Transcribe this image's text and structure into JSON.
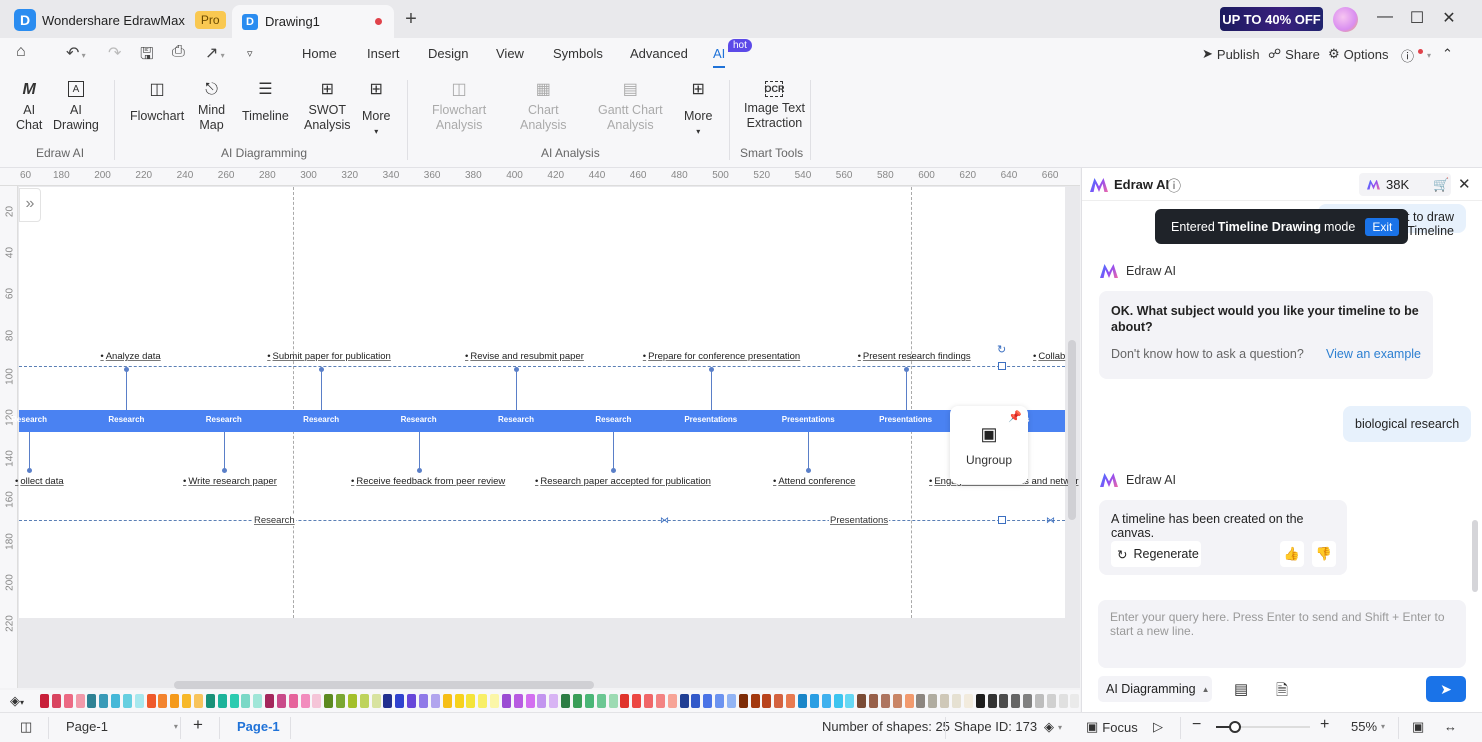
{
  "titlebar": {
    "app_name": "Wondershare EdrawMax",
    "pro_badge": "Pro",
    "doc_tab": "Drawing1",
    "promo": "UP TO 40% OFF"
  },
  "menubar": {
    "items": [
      "Home",
      "Insert",
      "Design",
      "View",
      "Symbols",
      "Advanced",
      "AI"
    ],
    "active": "AI",
    "hot_badge": "hot",
    "publish": "Publish",
    "share": "Share",
    "options": "Options"
  },
  "ribbon": {
    "groups": [
      {
        "label": "Edraw AI",
        "buttons": [
          {
            "label1": "AI",
            "label2": "Chat",
            "icon": "ai-chat-icon"
          },
          {
            "label1": "AI",
            "label2": "Drawing",
            "icon": "ai-drawing-icon"
          }
        ]
      },
      {
        "label": "AI Diagramming",
        "buttons": [
          {
            "label1": "Flowchart",
            "icon": "flowchart-icon"
          },
          {
            "label1": "Mind",
            "label2": "Map",
            "icon": "mind-map-icon"
          },
          {
            "label1": "Timeline",
            "icon": "timeline-icon"
          },
          {
            "label1": "SWOT",
            "label2": "Analysis",
            "icon": "swot-icon"
          },
          {
            "label1": "More",
            "icon": "plus-box-icon"
          }
        ]
      },
      {
        "label": "AI Analysis",
        "buttons": [
          {
            "label1": "Flowchart",
            "label2": "Analysis",
            "icon": "flowchart-analysis-icon",
            "disabled": true
          },
          {
            "label1": "Chart",
            "label2": "Analysis",
            "icon": "chart-analysis-icon",
            "disabled": true
          },
          {
            "label1": "Gantt Chart",
            "label2": "Analysis",
            "icon": "gantt-analysis-icon",
            "disabled": true
          },
          {
            "label1": "More",
            "icon": "plus-box-icon"
          }
        ]
      },
      {
        "label": "Smart Tools",
        "buttons": [
          {
            "label1": "Image Text",
            "label2": "Extraction",
            "icon": "ocr-icon"
          }
        ]
      }
    ]
  },
  "ruler": {
    "top_labels": [
      "60",
      "180",
      "200",
      "220",
      "240",
      "260",
      "280",
      "300",
      "320",
      "340",
      "360",
      "380",
      "400",
      "420",
      "440",
      "460",
      "480",
      "500",
      "520",
      "540",
      "560",
      "580",
      "600",
      "620",
      "640",
      "660"
    ],
    "left_labels": [
      "20",
      "40",
      "60",
      "80",
      "100",
      "120",
      "140",
      "160",
      "180",
      "200",
      "220"
    ]
  },
  "timeline": {
    "bar_labels": [
      "Research",
      "Research",
      "Research",
      "Research",
      "Research",
      "Research",
      "Research",
      "Presentations",
      "Presentations",
      "Presentations",
      "Presentations"
    ],
    "top_events": [
      "Analyze data",
      "Submit paper for publication",
      "Revise and resubmit paper",
      "Prepare for conference presentation",
      "Present research findings",
      "Collab"
    ],
    "bottom_events": [
      "ollect data",
      "Write research paper",
      "Receive feedback from peer review",
      "Research paper accepted for publication",
      "Attend conference",
      "Engage in discussions and networ"
    ],
    "phases": [
      "Research",
      "Presentations"
    ],
    "bar_color": "#4a82f2"
  },
  "popup": {
    "ungroup_label": "Ungroup"
  },
  "palette": {
    "colors": [
      "#c8203a",
      "#d94560",
      "#ec6a84",
      "#f29aaa",
      "#2f8294",
      "#3a9bb8",
      "#46b8d8",
      "#66cfe0",
      "#a8e8ee",
      "#ef5a2c",
      "#f3832e",
      "#f59a1c",
      "#f7b829",
      "#f8c45c",
      "#199178",
      "#1cb39a",
      "#2ccbb0",
      "#7ad8c6",
      "#a0e6d8",
      "#a4275c",
      "#c94b8a",
      "#e6649c",
      "#f28cbd",
      "#f5c5d8",
      "#5c8a20",
      "#7aa732",
      "#a3bf2a",
      "#bed35c",
      "#d8e3a0",
      "#22308f",
      "#3043cf",
      "#6847d9",
      "#8f79e8",
      "#b1a4ee",
      "#f6be16",
      "#f7d21c",
      "#f4e43a",
      "#f8ef68",
      "#fbf6a8",
      "#9b4cd3",
      "#b85be1",
      "#d36ff0",
      "#c395ef",
      "#d8b4f4",
      "#2d7d45",
      "#3a9e58",
      "#4ab677",
      "#6cc793",
      "#9ddbb3",
      "#e0342c",
      "#ec4743",
      "#f06668",
      "#f38383",
      "#f7a497",
      "#213f94",
      "#3259c9",
      "#4b74e6",
      "#6c93f0",
      "#92b4f4",
      "#7d2b06",
      "#a3380e",
      "#b9441d",
      "#d4623f",
      "#e87a50",
      "#1a86c8",
      "#2b9ee3",
      "#40b1ee",
      "#3dc4ef",
      "#66d8f4",
      "#7a4b35",
      "#98604a",
      "#ae7560",
      "#c98566",
      "#f29a6e",
      "#8d8680",
      "#b0aca0",
      "#cfc8b8",
      "#e6e1d2",
      "#f2ebdd",
      "#1c1c1c",
      "#333333",
      "#4d4d4d",
      "#666666",
      "#808080",
      "#bdbdbd",
      "#d0d0d0",
      "#e0e0e0",
      "#eaeaea",
      "#f6f6f6"
    ]
  },
  "statusbar": {
    "page_select": "Page-1",
    "page_tab": "Page-1",
    "shapes": "Number of shapes: 25",
    "shape_id": "Shape ID: 173",
    "focus": "Focus",
    "zoom": "55%",
    "zoom_fraction": 0.2
  },
  "ai_panel": {
    "title": "Edraw AI",
    "credits": "38K",
    "toast_prefix": "Entered",
    "toast_bold": "Timeline Drawing",
    "toast_suffix": "mode",
    "toast_exit": "Exit",
    "prev_user_msg": "I want to draw Timeline",
    "bot_name": "Edraw AI",
    "bot_msg1": "OK. What subject would you like your timeline to be about?",
    "hint_q": "Don't know how to ask a question?",
    "hint_link": "View an example",
    "user_msg": "biological research",
    "bot_msg2": "A timeline has been created on the canvas.",
    "regenerate": "Regenerate",
    "query_placeholder": "Enter your query here. Press Enter to send and Shift + Enter to start a new line.",
    "mode": "AI Diagramming"
  }
}
